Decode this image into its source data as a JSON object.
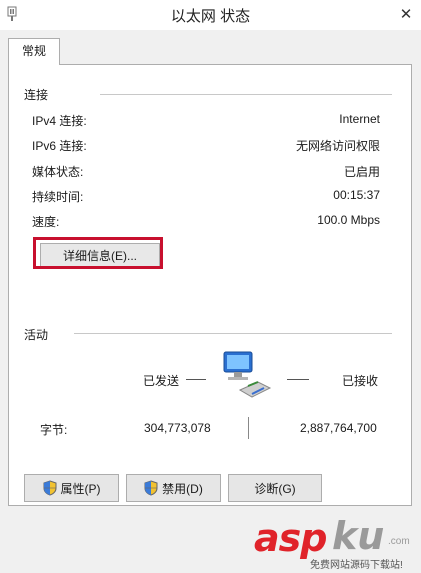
{
  "window": {
    "title": "以太网 状态",
    "close_glyph": "✕"
  },
  "tabs": [
    {
      "label": "常规"
    }
  ],
  "connection": {
    "section_label": "连接",
    "rows": [
      {
        "key": "IPv4 连接:",
        "value": "Internet"
      },
      {
        "key": "IPv6 连接:",
        "value": "无网络访问权限"
      },
      {
        "key": "媒体状态:",
        "value": "已启用"
      },
      {
        "key": "持续时间:",
        "value": "00:15:37"
      },
      {
        "key": "速度:",
        "value": "100.0 Mbps"
      }
    ],
    "details_button": "详细信息(E)...",
    "highlight_color": "#c8102e"
  },
  "activity": {
    "section_label": "活动",
    "sent_label": "已发送",
    "received_label": "已接收",
    "bytes_label": "字节:",
    "bytes_sent": "304,773,078",
    "bytes_received": "2,887,764,700",
    "icon": "network-computers-icon"
  },
  "buttons": {
    "properties": "属性(P)",
    "disable": "禁用(D)",
    "diagnose": "诊断(G)"
  },
  "watermark": {
    "brand_red": "asp",
    "brand_gray": "ku",
    "domain": ".com",
    "tagline": "免费网站源码下载站!"
  }
}
